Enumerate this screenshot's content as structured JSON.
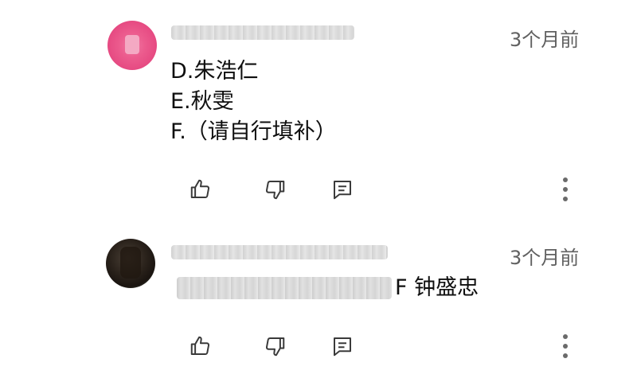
{
  "comments": [
    {
      "timestamp": "3个月前",
      "lines": [
        "D.朱浩仁",
        "E.秋雯",
        "F.（请自行填补）"
      ],
      "avatar_color": "#e64a82"
    },
    {
      "timestamp": "3个月前",
      "reply_text": "F 钟盛忠",
      "avatar_color": "#2a221b"
    }
  ],
  "icons": {
    "like": "thumbs-up-icon",
    "dislike": "thumbs-down-icon",
    "reply": "reply-comment-icon",
    "more": "more-vertical-icon"
  },
  "colors": {
    "text": "#0f0f0f",
    "secondary_text": "#606060",
    "icon": "#3a3a3a"
  }
}
